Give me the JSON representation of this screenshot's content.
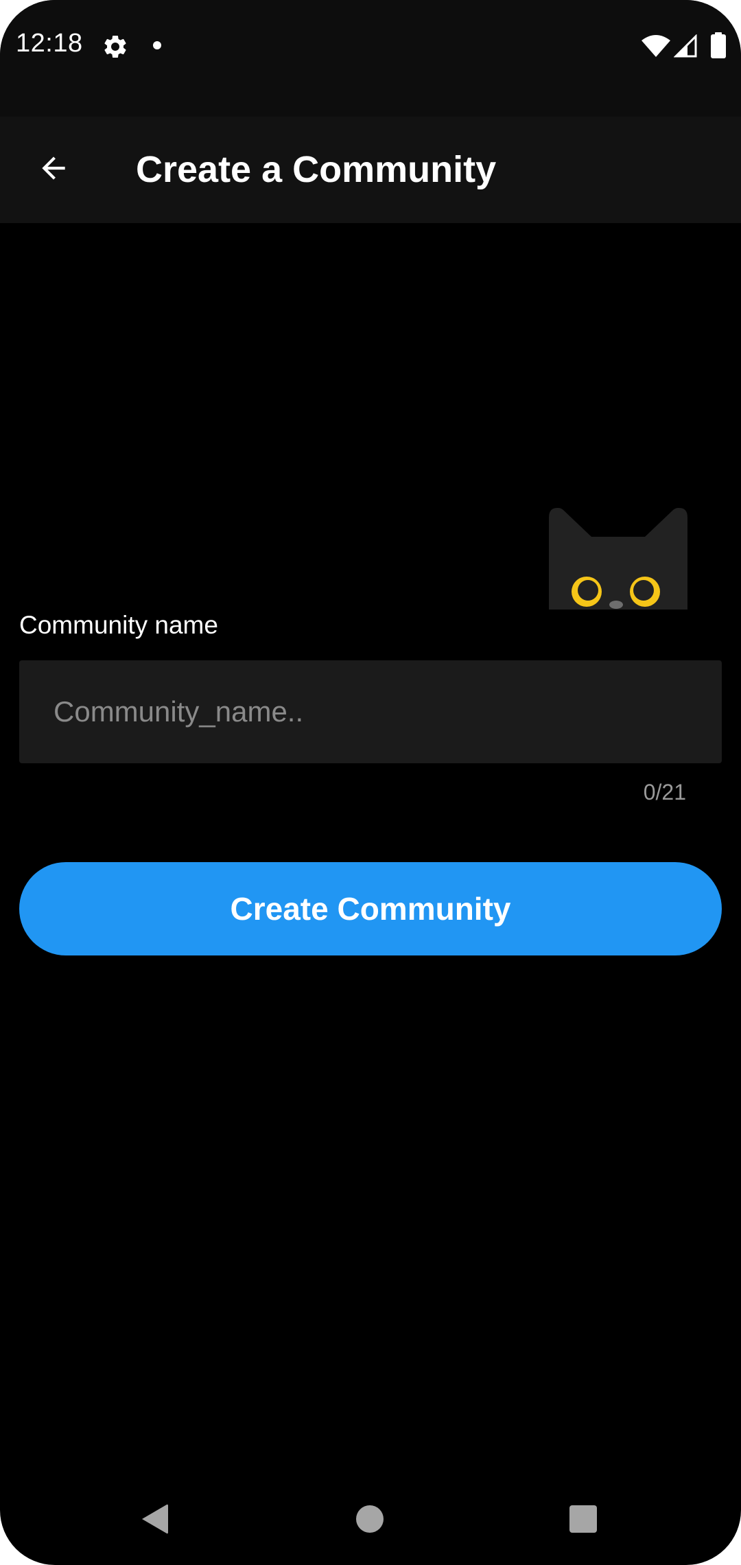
{
  "status_bar": {
    "time": "12:18",
    "icons": [
      "gear-icon",
      "dot-icon",
      "wifi-icon",
      "signal-icon",
      "battery-icon"
    ]
  },
  "app_bar": {
    "back_icon": "arrow-left-icon",
    "title": "Create a Community"
  },
  "form": {
    "label": "Community name",
    "input": {
      "value": "",
      "placeholder": "Community_name.."
    },
    "counter": "0/21",
    "submit_label": "Create Community"
  },
  "mascot": {
    "icon": "cat-mascot-icon",
    "eye_color": "#f5c518"
  },
  "nav_bar": {
    "icons": [
      "nav-back-icon",
      "nav-home-icon",
      "nav-recents-icon"
    ]
  },
  "colors": {
    "accent": "#2196f3",
    "background": "#000000",
    "app_bar": "#121212",
    "input_background": "#1b1b1b"
  }
}
